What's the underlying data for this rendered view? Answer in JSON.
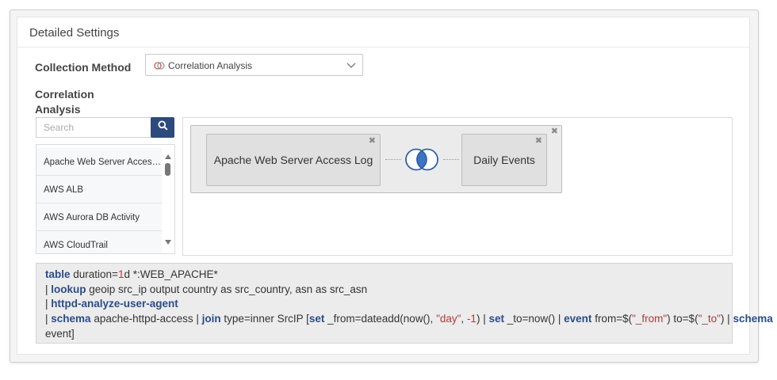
{
  "section_title": "Detailed Settings",
  "collection_method": {
    "label": "Collection Method",
    "selected": "Correlation Analysis",
    "icon": "venn-icon"
  },
  "correlation": {
    "label": "Correlation Analysis",
    "search_placeholder": "Search",
    "sources": [
      "Apache Web Server Access Log",
      "AWS ALB",
      "AWS Aurora DB Activity",
      "AWS CloudTrail"
    ]
  },
  "diagram": {
    "left_node": "Apache Web Server Access Log",
    "right_node": "Daily Events",
    "close_glyph": "✖",
    "join_icon": "venn-inner-join-icon"
  },
  "query": {
    "line1": {
      "kw1": "table",
      "t1": " duration=",
      "n1": "1",
      "t2": "d *:WEB_APACHE*"
    },
    "line2": {
      "p": "| ",
      "kw1": "lookup",
      "t1": " geoip src_ip output country as src_country, asn as src_asn"
    },
    "line3": {
      "p": "| ",
      "kw1": "httpd-analyze-user-agent"
    },
    "line4": {
      "p": "| ",
      "kw1": "schema",
      "t1": " apache-httpd-access | ",
      "kw2": "join",
      "t2": " type=inner SrcIP [",
      "kw3": "set",
      "t3": " _from=dateadd(now(), ",
      "s1": "\"day\"",
      "t4": ", ",
      "n1": "-1",
      "t5": ") | ",
      "kw4": "set",
      "t6": " _to=now() | ",
      "kw5": "event",
      "t7": " from=$(",
      "s2": "\"_from\"",
      "t8": ") to=$(",
      "s3": "\"_to\"",
      "t9": ") | ",
      "kw6": "schema"
    },
    "line5": {
      "t1": "event]"
    }
  },
  "colors": {
    "accent": "#2d4a7c",
    "keyword": "#2b4c8a",
    "string": "#b03a3a"
  }
}
